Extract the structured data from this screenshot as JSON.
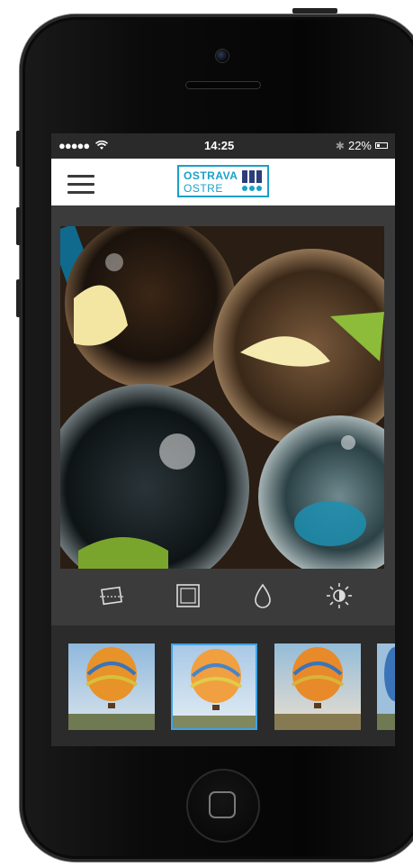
{
  "status_bar": {
    "signal": "●●●●●",
    "wifi_icon": "wifi-icon",
    "time": "14:25",
    "bluetooth_icon": "bluetooth-icon",
    "battery": "22%"
  },
  "header": {
    "menu_icon": "hamburger-menu-icon",
    "logo": {
      "line1": "OSTRAVA",
      "line2": "OSTRE"
    }
  },
  "editor": {
    "photo_subject": "glasses-of-drinks-with-lime",
    "tools": [
      {
        "name": "crop-rotate-icon"
      },
      {
        "name": "frame-icon"
      },
      {
        "name": "drop-icon"
      },
      {
        "name": "brightness-icon"
      }
    ]
  },
  "filters": {
    "thumbnails": [
      {
        "name": "filter-thumbnail-1",
        "selected": false
      },
      {
        "name": "filter-thumbnail-2",
        "selected": true
      },
      {
        "name": "filter-thumbnail-3",
        "selected": false
      },
      {
        "name": "filter-thumbnail-4",
        "selected": false
      }
    ]
  },
  "colors": {
    "accent": "#3fa3e6",
    "logo_blue": "#1aa0c8",
    "toolbar_bg": "#3b3b3b",
    "tray_bg": "#2b2b2b"
  }
}
